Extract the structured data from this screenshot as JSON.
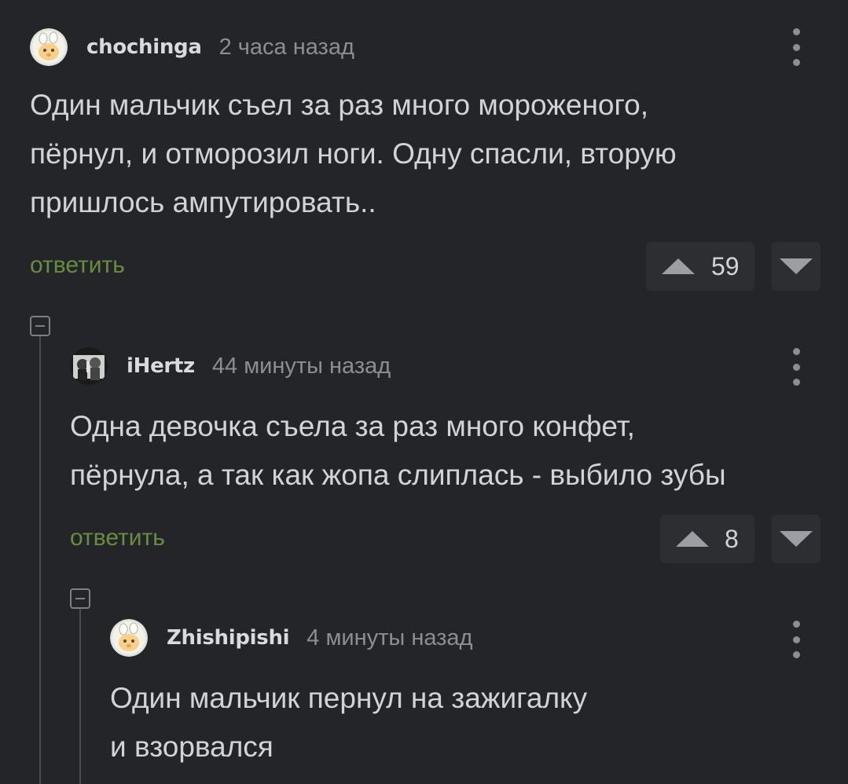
{
  "comments": [
    {
      "username": "chochinga",
      "time": "2 часа назад",
      "text": "Один мальчик съел за раз много мороженого,\nпёрнул, и отморозил ноги. Одну спасли, вторую\nпришлось ампутировать..",
      "reply_label": "ответить",
      "score": "59",
      "avatar": "bunny-avatar-icon"
    },
    {
      "username": "iHertz",
      "time": "44 минуты назад",
      "text": "Одна девочка съела за раз много конфет,\nпёрнула, а так как жопа слиплась - выбило зубы",
      "reply_label": "ответить",
      "score": "8",
      "avatar": "photo-avatar-icon"
    },
    {
      "username": "Zhishipishi",
      "time": "4 минуты назад",
      "text": "Один мальчик пернул на зажигалку\nи взорвался",
      "avatar": "bunny-avatar-icon"
    }
  ],
  "colors": {
    "background": "#242528",
    "reply": "#6a8b42",
    "muted": "#8c8e93"
  }
}
